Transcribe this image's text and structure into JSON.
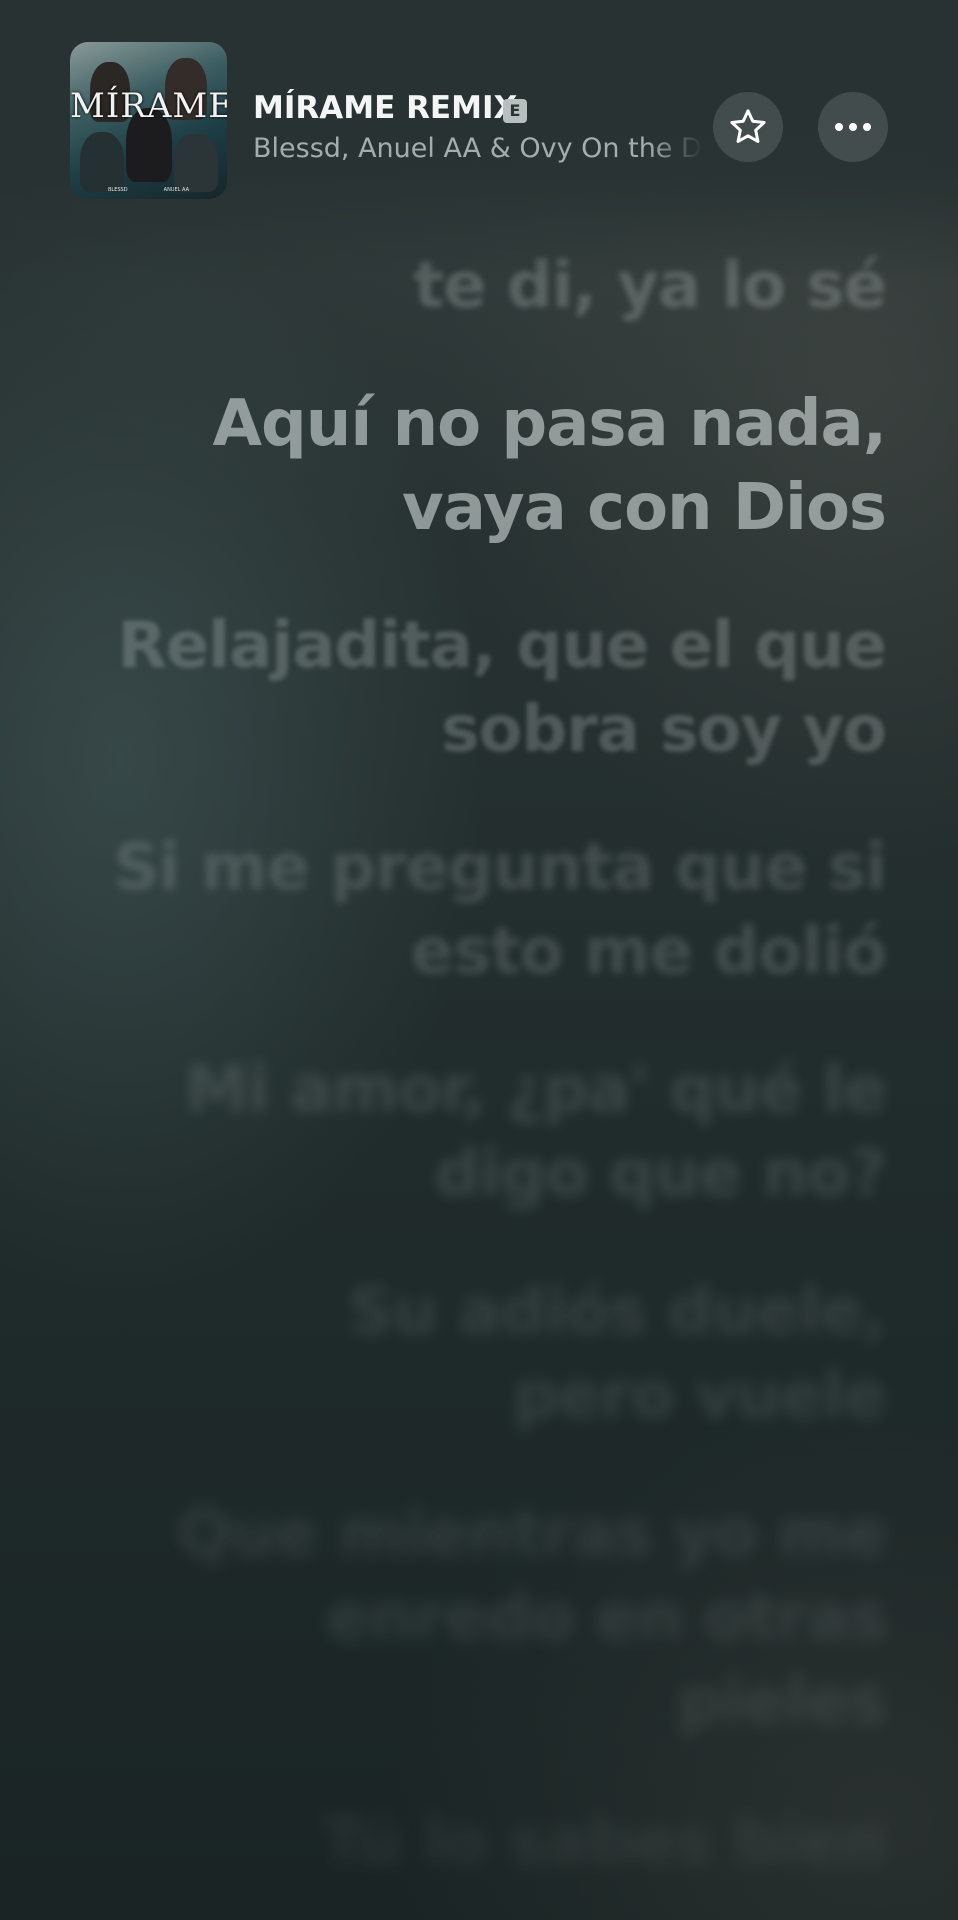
{
  "track": {
    "title": "MÍRAME REMIX",
    "explicit_badge": "E",
    "artists": "Blessd, Anuel AA & Ovy On the Drums",
    "cover": {
      "title": "MÍRAME",
      "credit_left": "BLESSD",
      "credit_right": "ANUEL AA"
    }
  },
  "actions": {
    "favorite_icon": "star-outline-icon",
    "more_icon": "ellipsis-icon"
  },
  "lyrics": [
    {
      "lines": [
        "te di, ya lo sé"
      ],
      "state": "past"
    },
    {
      "lines": [
        "Aquí no pasa nada,",
        "vaya con Dios"
      ],
      "state": "current"
    },
    {
      "lines": [
        "Relajadita, que el que",
        "sobra soy yo"
      ],
      "state": "upcoming"
    },
    {
      "lines": [
        "Si me pregunta que si",
        "esto me dolió"
      ],
      "state": "upcoming"
    },
    {
      "lines": [
        "Mi amor, ¿pa' qué le",
        "digo que no?"
      ],
      "state": "upcoming"
    },
    {
      "lines": [
        "Su adiós duele,",
        "pero vuele"
      ],
      "state": "upcoming"
    },
    {
      "lines": [
        "Que mientras yo me",
        "enredo en otras",
        "pieles"
      ],
      "state": "upcoming"
    },
    {
      "lines": [
        "Tú lo sabes bien"
      ],
      "state": "upcoming"
    }
  ]
}
